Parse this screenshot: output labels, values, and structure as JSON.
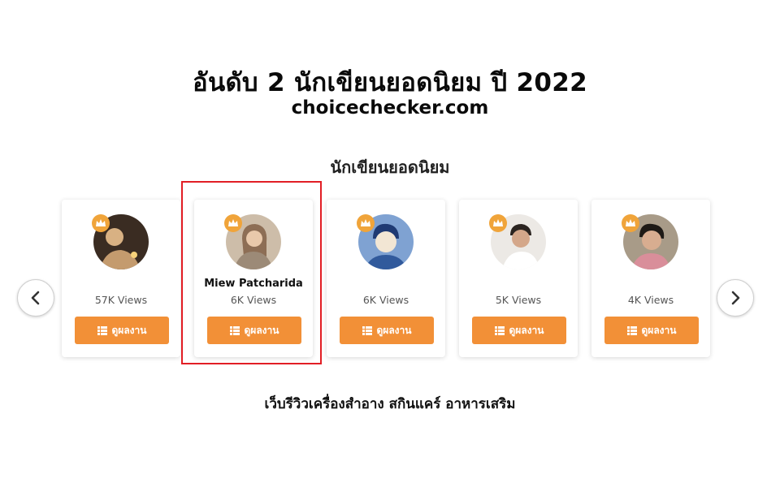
{
  "headline": "อันดับ 2 นักเขียนยอดนิยม ปี 2022",
  "site": "choicechecker.com",
  "section_title": "นักเขียนยอดนิยม",
  "carousel": {
    "prev_icon": "chevron-left-icon",
    "next_icon": "chevron-right-icon",
    "cards": [
      {
        "name": "",
        "views": "57K Views",
        "button_label": "ดูผลงาน",
        "avatar_colors": [
          "#4a3a2c",
          "#d8b183"
        ]
      },
      {
        "name": "Miew Patcharida",
        "views": "6K Views",
        "button_label": "ดูผลงาน",
        "avatar_colors": [
          "#c9b7a3",
          "#8d6e55"
        ]
      },
      {
        "name": "",
        "views": "6K Views",
        "button_label": "ดูผลงาน",
        "avatar_colors": [
          "#6f94c7",
          "#e7ecf5"
        ]
      },
      {
        "name": "",
        "views": "5K Views",
        "button_label": "ดูผลงาน",
        "avatar_colors": [
          "#e9e6e2",
          "#c9a184"
        ]
      },
      {
        "name": "",
        "views": "4K Views",
        "button_label": "ดูผลงาน",
        "avatar_colors": [
          "#a79a86",
          "#caa288"
        ]
      }
    ],
    "highlighted_index": 1
  },
  "tagline": "เว็บรีวิวเครื่องสำอาง สกินแคร์ อาหารเสริม",
  "colors": {
    "accent": "#f29037",
    "highlight_border": "#e21e25",
    "crown": "#f0a43a"
  }
}
